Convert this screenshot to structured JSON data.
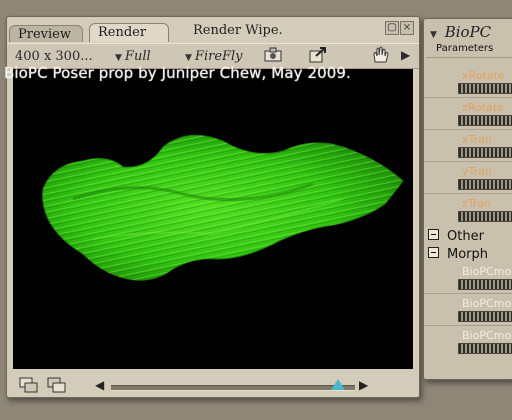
{
  "render_window": {
    "tabs": [
      "Preview",
      "Render"
    ],
    "wipe_label": "Render Wipe.",
    "resolution": "400 x 300...",
    "mode_full": "Full",
    "mode_renderer": "FireFly"
  },
  "caption": "BioPC Poser prop by Juniper Chew, May 2009.",
  "panel": {
    "title": "BioPC",
    "parameters_header": "Parameters",
    "dials": [
      {
        "label": "xRotate"
      },
      {
        "label": "zRotate"
      },
      {
        "label": "xTran"
      },
      {
        "label": "yTran"
      },
      {
        "label": "zTran"
      }
    ],
    "groups": [
      "Other",
      "Morph"
    ],
    "morph_dials": [
      {
        "label": "BioPCmo"
      },
      {
        "label": "BioPCmo"
      },
      {
        "label": "BioPCmo"
      }
    ]
  },
  "colors": {
    "render_bg": "#000000",
    "fur_green": "#39d614",
    "slider_knob": "#49b7c9"
  },
  "slider": {
    "value": 0.93
  }
}
